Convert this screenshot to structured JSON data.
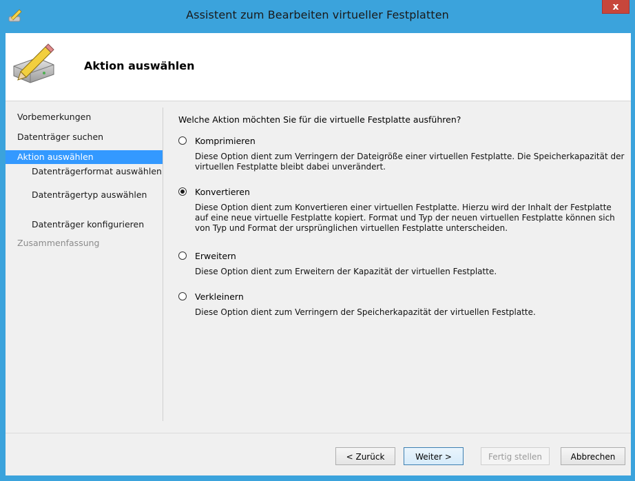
{
  "window": {
    "title": "Assistent zum Bearbeiten virtueller Festplatten",
    "close_label": "x"
  },
  "header": {
    "title": "Aktion auswählen"
  },
  "nav": {
    "items": [
      {
        "label": "Vorbemerkungen",
        "state": "normal"
      },
      {
        "label": "Datenträger suchen",
        "state": "normal"
      },
      {
        "label": "Aktion auswählen",
        "state": "selected"
      },
      {
        "label": "Datenträgerformat auswählen",
        "state": "normal"
      },
      {
        "label": "Datenträgertyp auswählen",
        "state": "normal"
      },
      {
        "label": "Datenträger konfigurieren",
        "state": "normal"
      },
      {
        "label": "Zusammenfassung",
        "state": "disabled"
      }
    ]
  },
  "main": {
    "question": "Welche Aktion möchten Sie für die virtuelle Festplatte ausführen?",
    "options": [
      {
        "label": "Komprimieren",
        "checked": false,
        "description": "Diese Option dient zum Verringern der Dateigröße einer virtuellen Festplatte. Die Speicherkapazität der virtuellen Festplatte bleibt dabei unverändert."
      },
      {
        "label": "Konvertieren",
        "checked": true,
        "description": "Diese Option dient zum Konvertieren einer virtuellen Festplatte. Hierzu wird der Inhalt der Festplatte auf eine neue virtuelle Festplatte kopiert. Format und Typ der neuen virtuellen Festplatte können sich von Typ und Format der ursprünglichen virtuellen Festplatte unterscheiden."
      },
      {
        "label": "Erweitern",
        "checked": false,
        "description": "Diese Option dient zum Erweitern der Kapazität der virtuellen Festplatte."
      },
      {
        "label": "Verkleinern",
        "checked": false,
        "description": "Diese Option dient zum Verringern der Speicherkapazität der virtuellen Festplatte."
      }
    ]
  },
  "buttons": {
    "back": "< Zurück",
    "next": "Weiter >",
    "finish": "Fertig stellen",
    "cancel": "Abbrechen"
  },
  "colors": {
    "titlebar": "#3ba3dc",
    "selection": "#3399ff",
    "close": "#c7463b"
  }
}
